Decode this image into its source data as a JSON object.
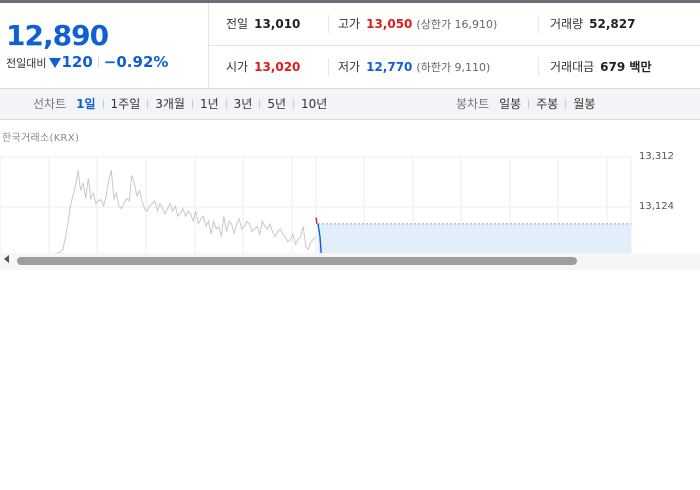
{
  "quote": {
    "current_price": "12,890",
    "change_label": "전일대비",
    "change_amount": "120",
    "change_rate": "−0.92%"
  },
  "stats": {
    "prev_close_label": "전일",
    "prev_close": "13,010",
    "high_label": "고가",
    "high": "13,050",
    "upper_limit": "(상한가 16,910)",
    "volume_label": "거래량",
    "volume": "52,827",
    "open_label": "시가",
    "open": "13,020",
    "low_label": "저가",
    "low": "12,770",
    "lower_limit": "(하한가 9,110)",
    "trade_value_label": "거래대금",
    "trade_value": "679 백만"
  },
  "line_tabs": {
    "title": "선차트",
    "items": [
      "1일",
      "1주일",
      "3개월",
      "1년",
      "3년",
      "5년",
      "10년"
    ],
    "active": 0
  },
  "candle_tabs": {
    "title": "봉차트",
    "items": [
      "일봉",
      "주봉",
      "월봉"
    ]
  },
  "chart": {
    "source": "한국거래소(KRX)",
    "y_ticks": [
      "13,312",
      "13,124"
    ],
    "colors": {
      "history": "#c8c8c8",
      "today_up": "#e01b1b",
      "today_down": "#1060d4",
      "fill": "#e3eefb"
    }
  },
  "chart_data": {
    "type": "line",
    "title": "",
    "y_ticks": [
      13312,
      13124
    ],
    "ylim": [
      12936,
      13312
    ],
    "series": [
      {
        "values": [
          12936,
          12936,
          12940,
          12950,
          12990,
          13050,
          13120,
          13160,
          13200,
          13260,
          13180,
          13210,
          13150,
          13230,
          13150,
          13170,
          13130,
          13140,
          13145,
          13120,
          13160,
          13220,
          13260,
          13150,
          13170,
          13120,
          13110,
          13130,
          13150,
          13140,
          13240,
          13210,
          13160,
          13180,
          13140,
          13110,
          13100,
          13120,
          13130,
          13140,
          13100,
          13130,
          13110,
          13090,
          13110,
          13130,
          13100,
          13120,
          13080,
          13090,
          13110,
          13080,
          13100,
          13090,
          13060,
          13100,
          13050,
          13070,
          13080,
          13040,
          13060,
          13010,
          13060,
          13030,
          13040,
          13000,
          13080,
          13020,
          13060,
          13050,
          13010,
          13050,
          13070,
          13030,
          13040,
          13060,
          13050,
          13020,
          13030,
          13040,
          13010,
          13060,
          13040,
          13030,
          13050,
          13020,
          13000,
          13020,
          13030,
          13010,
          13000,
          12980,
          12990,
          13010,
          12970,
          12990,
          13000,
          13040,
          12960,
          12950,
          12980,
          12990,
          13000
        ]
      },
      {
        "values": [
          13050,
          13000,
          12890
        ]
      }
    ]
  }
}
